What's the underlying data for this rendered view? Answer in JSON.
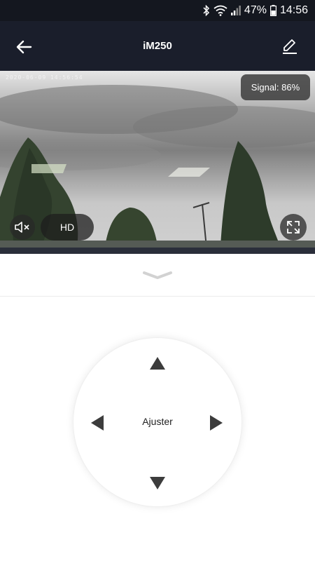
{
  "status_bar": {
    "battery": "47%",
    "time": "14:56",
    "icons": [
      "bluetooth-icon",
      "wifi-icon",
      "signal-icon",
      "battery-icon"
    ]
  },
  "app_bar": {
    "title": "iM250",
    "back_icon": "arrow-left-icon",
    "edit_icon": "pencil-icon"
  },
  "video": {
    "osd_timestamp": "2020-06-09 14:56:54",
    "signal_label": "Signal: 86%",
    "mute_icon": "speaker-muted-icon",
    "quality_label": "HD",
    "fullscreen_icon": "expand-icon"
  },
  "controls": {
    "collapse_icon": "chevron-down-icon",
    "ptz_center_label": "Ajuster",
    "ptz_icons": [
      "triangle-up-icon",
      "triangle-down-icon",
      "triangle-left-icon",
      "triangle-right-icon"
    ]
  },
  "colors": {
    "status_bar_bg": "#14171f",
    "app_bar_bg": "#1a1e2b",
    "arrow_color": "#3c3c3c"
  }
}
